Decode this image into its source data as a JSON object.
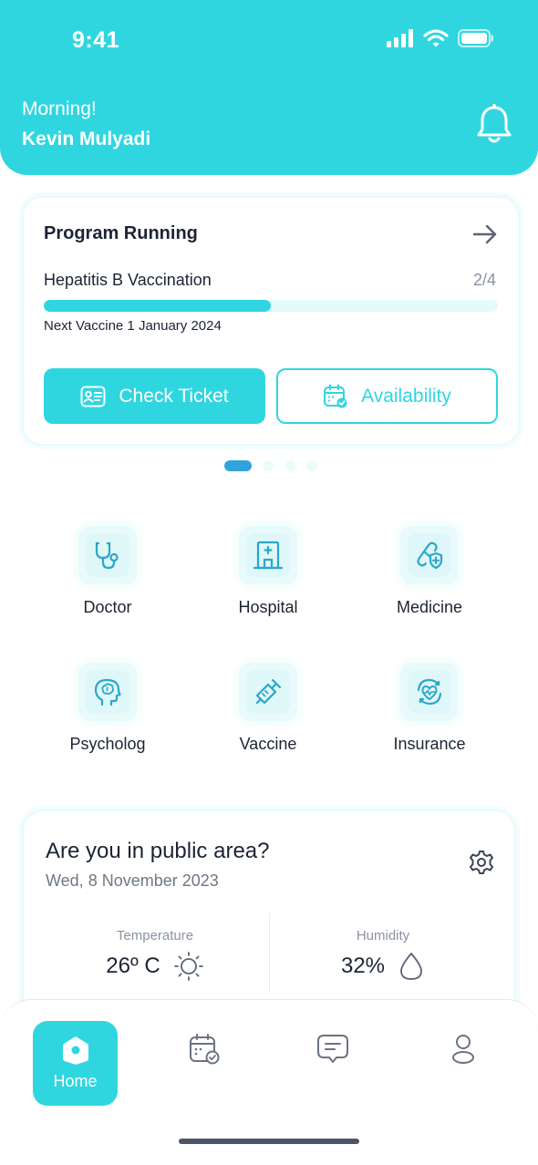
{
  "status_bar": {
    "time": "9:41"
  },
  "header": {
    "greeting": "Morning!",
    "user_name": "Kevin Mulyadi"
  },
  "program_card": {
    "title": "Program Running",
    "program_name": "Hepatitis B Vaccination",
    "progress_text": "2/4",
    "progress_fraction": 0.5,
    "next_vaccine": "Next Vaccine 1 January 2024",
    "check_ticket_label": "Check Ticket",
    "availability_label": "Availability"
  },
  "pagination": {
    "total": 4,
    "active": 0
  },
  "services": [
    {
      "label": "Doctor",
      "icon": "stethoscope-icon"
    },
    {
      "label": "Hospital",
      "icon": "hospital-icon"
    },
    {
      "label": "Medicine",
      "icon": "pill-icon"
    },
    {
      "label": "Psycholog",
      "icon": "brain-head-icon"
    },
    {
      "label": "Vaccine",
      "icon": "syringe-icon"
    },
    {
      "label": "Insurance",
      "icon": "heart-shield-icon"
    }
  ],
  "public_area": {
    "title": "Are you in public area?",
    "date": "Wed, 8 November 2023",
    "temperature_label": "Temperature",
    "temperature_value": "26º C",
    "humidity_label": "Humidity",
    "humidity_value": "32%"
  },
  "bottom_nav": {
    "home_label": "Home",
    "items": [
      "home-icon",
      "calendar-icon",
      "chat-icon",
      "profile-icon"
    ]
  },
  "colors": {
    "primary": "#2fd6e0",
    "text": "#1c2434",
    "muted": "#8a93a0"
  }
}
